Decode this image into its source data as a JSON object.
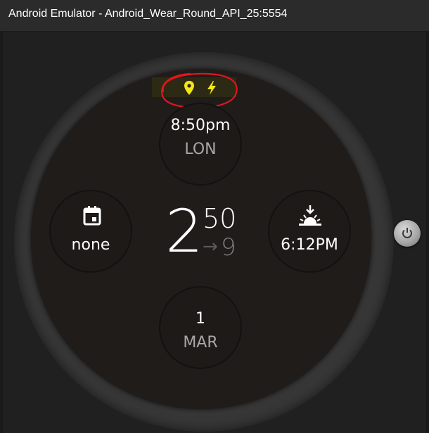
{
  "window": {
    "title": "Android Emulator - Android_Wear_Round_API_25:5554"
  },
  "notifications": {
    "icons": [
      "location-pin-icon",
      "charging-bolt-icon"
    ],
    "accent_color": "#f5e614",
    "annotation_color": "#e0161b"
  },
  "watchface": {
    "time": {
      "hour": "2",
      "minute": "50",
      "second": "9",
      "separator_glyph": "→"
    },
    "complications": {
      "top": {
        "value": "8:50pm",
        "label": "LON"
      },
      "left": {
        "icon": "calendar-icon",
        "value": "none"
      },
      "right": {
        "icon": "sunrise-icon",
        "value": "6:12PM"
      },
      "bottom": {
        "value": "1",
        "label": "MAR"
      }
    }
  },
  "controls": {
    "power_icon": "power-icon"
  },
  "colors": {
    "dial": "#201c1a",
    "titlebar": "#2b2b2b",
    "text_primary": "#ffffff",
    "text_secondary": "#a7a7a7"
  }
}
